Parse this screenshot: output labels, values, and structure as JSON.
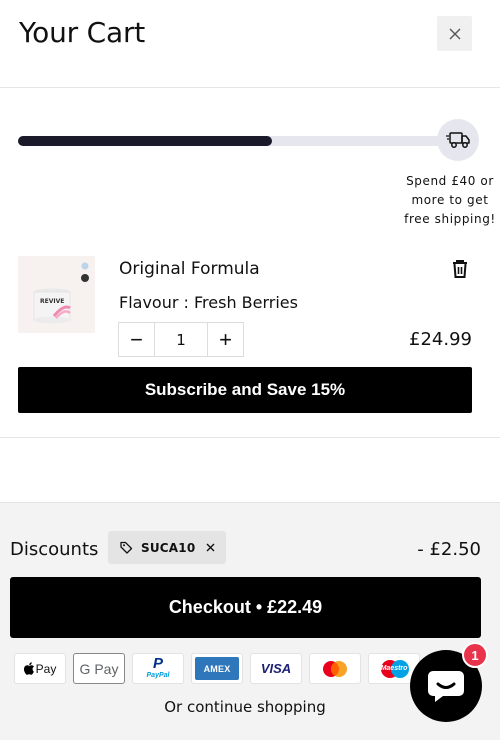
{
  "header": {
    "title": "Your Cart",
    "close_icon": "close-icon"
  },
  "shipping": {
    "progress": 0.59,
    "message_lines": [
      "Spend £40 or",
      "more to get",
      "free shipping!"
    ],
    "icon": "truck-icon"
  },
  "item": {
    "name": "Original Formula",
    "variant": "Flavour : Fresh Berries",
    "quantity": "1",
    "price": "£24.99",
    "minus": "−",
    "plus": "+",
    "image_label": "REVIVE"
  },
  "subscribe_label": "Subscribe and Save 15%",
  "discounts": {
    "label": "Discounts",
    "code": "SUCA10",
    "amount": "- £2.50"
  },
  "checkout_label": "Checkout • £22.49",
  "payments": {
    "applepay": "Pay",
    "googlepay": "G Pay",
    "paypal": "PayPal",
    "amex": "AMEX",
    "visa": "VISA",
    "maestro": "Maestro"
  },
  "continue_label": "Or continue shopping",
  "chat": {
    "badge": "1"
  },
  "colors": {
    "primary_button": "#000000",
    "badge": "#e8334a",
    "progress_fill": "#1a1a2a",
    "progress_track": "#e6e6ef",
    "footer_bg": "#f3f3f3"
  }
}
